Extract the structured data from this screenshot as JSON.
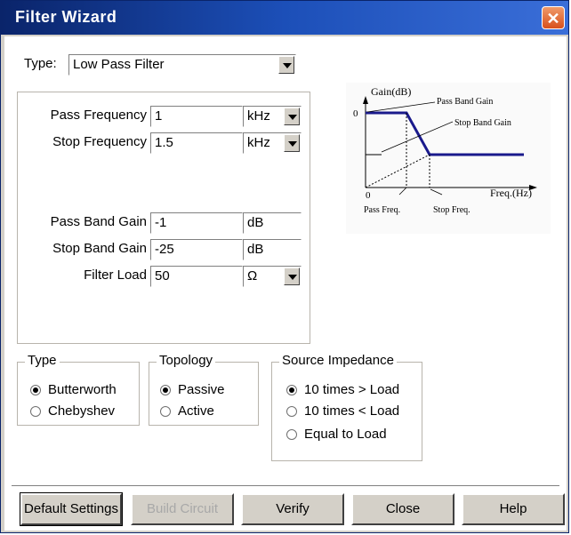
{
  "window": {
    "title": "Filter Wizard",
    "close_glyph": "✕"
  },
  "type_select": {
    "label": "Type:",
    "value": "Low Pass Filter"
  },
  "fields": {
    "pass_frequency": {
      "label": "Pass Frequency",
      "value": "1",
      "unit": "kHz"
    },
    "stop_frequency": {
      "label": "Stop Frequency",
      "value": "1.5",
      "unit": "kHz"
    },
    "pass_band_gain": {
      "label": "Pass Band Gain",
      "value": "-1",
      "unit": "dB"
    },
    "stop_band_gain": {
      "label": "Stop Band Gain",
      "value": "-25",
      "unit": "dB"
    },
    "filter_load": {
      "label": "Filter Load",
      "value": "50",
      "unit": "Ω"
    }
  },
  "diagram": {
    "y_axis_label": "Gain(dB)",
    "x_axis_label": "Freq.(Hz)",
    "y_zero": "0",
    "x_zero": "0",
    "pass_band_gain_label": "Pass Band Gain",
    "stop_band_gain_label": "Stop Band Gain",
    "pass_freq_label": "Pass Freq.",
    "stop_freq_label": "Stop Freq."
  },
  "groups": {
    "type": {
      "title": "Type",
      "options": [
        "Butterworth",
        "Chebyshev"
      ],
      "selected": "Butterworth"
    },
    "topology": {
      "title": "Topology",
      "options": [
        "Passive",
        "Active"
      ],
      "selected": "Passive"
    },
    "source_impedance": {
      "title": "Source Impedance",
      "options": [
        "10 times > Load",
        "10 times < Load",
        "Equal to Load"
      ],
      "selected": "10 times > Load"
    }
  },
  "buttons": {
    "default_settings": "Default Settings",
    "build_circuit": "Build Circuit",
    "verify": "Verify",
    "close": "Close",
    "help": "Help"
  },
  "colors": {
    "title_bar": "#0a246a",
    "curve": "#1a1a8c",
    "dialog_face": "#d4d0c8"
  }
}
